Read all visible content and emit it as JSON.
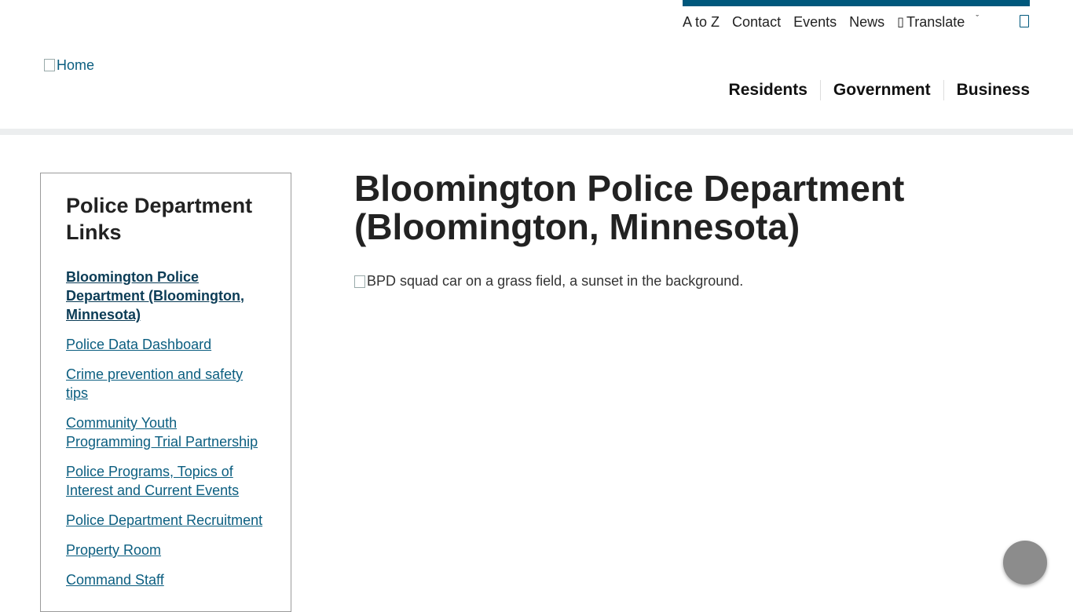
{
  "header": {
    "utility_nav": [
      "A to Z",
      "Contact",
      "Events",
      "News"
    ],
    "translate_label": "Translate",
    "logo_alt": "Home",
    "main_nav": [
      "Residents",
      "Government",
      "Business"
    ],
    "accent_color": "#00587c"
  },
  "sidebar": {
    "title": "Police Department Links",
    "items": [
      {
        "label": "Bloomington Police Department (Bloomington, Minnesota)",
        "active": true
      },
      {
        "label": "Police Data Dashboard"
      },
      {
        "label": "Crime prevention and safety tips"
      },
      {
        "label": "Community Youth Programming Trial Partnership"
      },
      {
        "label": "Police Programs, Topics of Interest and Current Events"
      },
      {
        "label": "Police Department Recruitment"
      },
      {
        "label": "Property Room"
      },
      {
        "label": "Command Staff"
      }
    ]
  },
  "main": {
    "title": "Bloomington Police Department (Bloomington, Minnesota)",
    "image_alt": "BPD squad car on a grass field, a sunset in the background."
  }
}
